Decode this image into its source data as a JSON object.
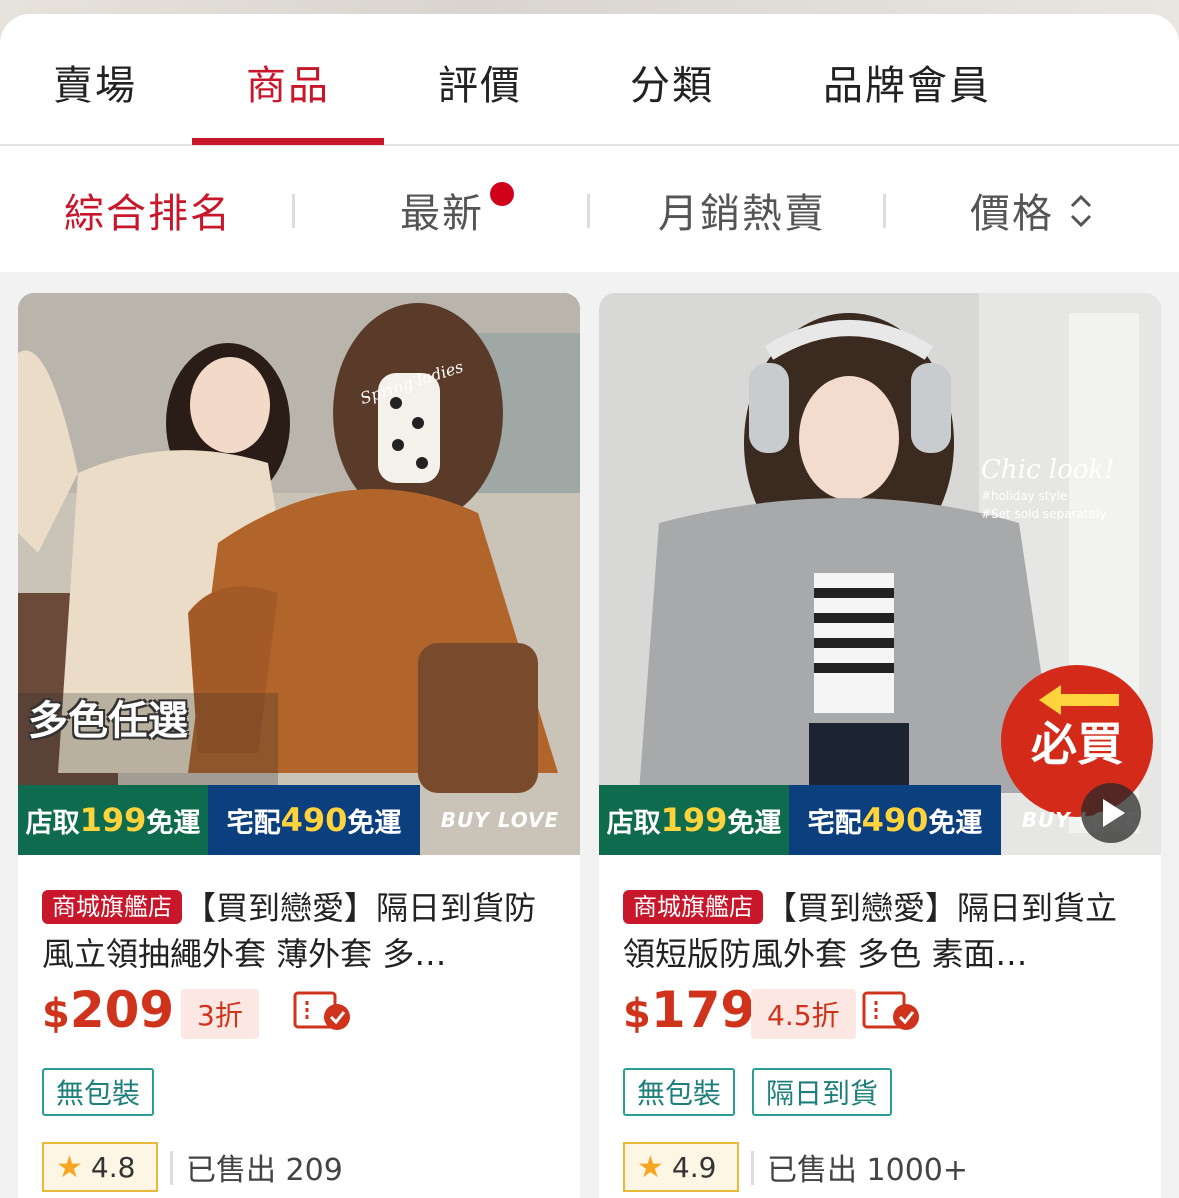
{
  "tabs": [
    "賣場",
    "商品",
    "評價",
    "分類",
    "品牌會員"
  ],
  "active_tab": "商品",
  "sort": {
    "items": [
      "綜合排名",
      "最新",
      "月銷熱賣",
      "價格"
    ],
    "active": "綜合排名"
  },
  "products": [
    {
      "mall_badge": "商城旗艦店",
      "title": "【買到戀愛】隔日到貨防風立領抽繩外套 薄外套 多…",
      "currency": "$",
      "price": "209",
      "discount": "3折",
      "tags": [
        "無包裝"
      ],
      "rating": "4.8",
      "sold": "已售出 209",
      "banner": {
        "pickup": "店取",
        "pickup_amt": "199",
        "pickup_free": "免運",
        "home": "宅配",
        "home_amt": "490",
        "home_free": "免運",
        "brand": "BUY LOVE"
      },
      "overlay_text": "多色任選",
      "photo_script": "Spring ladies"
    },
    {
      "mall_badge": "商城旗艦店",
      "title": "【買到戀愛】隔日到貨立領短版防風外套 多色 素面…",
      "currency": "$",
      "price": "179",
      "discount": "4.5折",
      "tags": [
        "無包裝",
        "隔日到貨"
      ],
      "rating": "4.9",
      "sold": "已售出 1000+",
      "banner": {
        "pickup": "店取",
        "pickup_amt": "199",
        "pickup_free": "免運",
        "home": "宅配",
        "home_amt": "490",
        "home_free": "免運",
        "brand": "BUY LOVE"
      },
      "overlay_text": "必買",
      "photo_script": "Chic look!",
      "photo_sub1": "#holiday style",
      "photo_sub2": "#Set sold separately"
    }
  ],
  "colors": {
    "accent": "#c8162b",
    "price": "#d0331b",
    "tag": "#2a9d97",
    "rating_border": "#e8b93a"
  }
}
